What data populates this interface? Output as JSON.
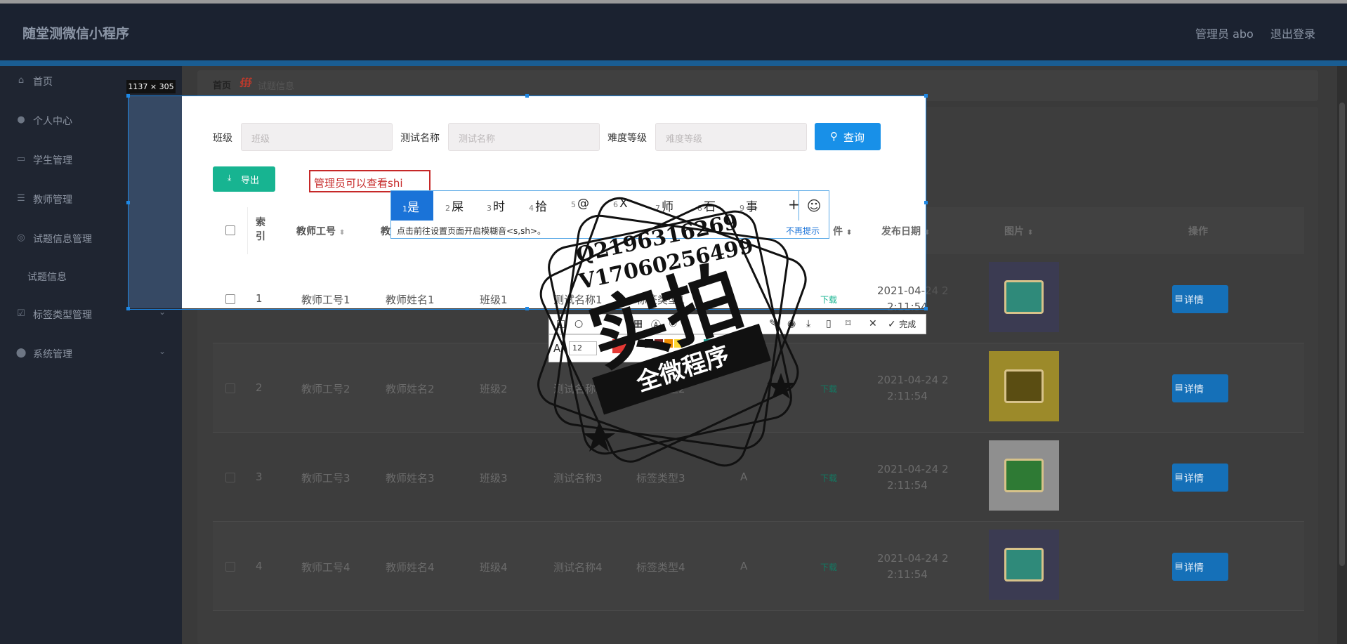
{
  "app": {
    "title": "随堂测微信小程序",
    "user": "管理员 abo",
    "logout": "退出登录"
  },
  "sidebar": {
    "items": [
      {
        "label": "首页",
        "icon": "home-icon"
      },
      {
        "label": "个人中心",
        "icon": "user-icon"
      },
      {
        "label": "学生管理",
        "icon": "chat-icon"
      },
      {
        "label": "教师管理",
        "icon": "list-icon"
      },
      {
        "label": "试题信息管理",
        "icon": "globe-icon"
      },
      {
        "label": "试题信息",
        "icon": ""
      },
      {
        "label": "标签类型管理",
        "icon": "checkbox-icon"
      },
      {
        "label": "系统管理",
        "icon": "location-icon"
      }
    ]
  },
  "breadcrumb": {
    "home": "首页",
    "current": "试题信息"
  },
  "filters": {
    "class_label": "班级",
    "class_placeholder": "班级",
    "test_label": "测试名称",
    "test_placeholder": "测试名称",
    "difficulty_label": "难度等级",
    "difficulty_placeholder": "难度等级",
    "query": "查询"
  },
  "toolbar": {
    "export": "导出"
  },
  "screenshot_tool": {
    "size_tag": "1137 × 305",
    "annotation_text": "管理员可以查看shi",
    "done": "完成",
    "font_size": "12"
  },
  "ime": {
    "candidates": [
      {
        "n": "1",
        "w": "是"
      },
      {
        "n": "2",
        "w": "屎"
      },
      {
        "n": "3",
        "w": "时"
      },
      {
        "n": "4",
        "w": "拾"
      },
      {
        "n": "5",
        "w": "@"
      },
      {
        "n": "6",
        "w": "X"
      },
      {
        "n": "7",
        "w": "师"
      },
      {
        "n": "8",
        "w": "石"
      },
      {
        "n": "9",
        "w": "事"
      }
    ],
    "plus": "+",
    "hint": "点击前往设置页面开启模糊音<s,sh>。",
    "no_hint": "不再提示"
  },
  "table": {
    "headers": [
      "索引",
      "教师工号",
      "教",
      "件",
      "发布日期",
      "图片",
      "操作"
    ],
    "rows": [
      {
        "index": "1",
        "tid": "教师工号1",
        "tname": "教师姓名1",
        "cls": "班级1",
        "test": "测试名称1",
        "tag": "标签类型1",
        "level": "",
        "file": "下载",
        "date1": "2021-04-24 2",
        "date2": "2:11:54",
        "action": "详情"
      },
      {
        "index": "2",
        "tid": "教师工号2",
        "tname": "教师姓名2",
        "cls": "班级2",
        "test": "测试名称2",
        "tag": "标签类型2",
        "level": "",
        "file": "下载",
        "date1": "2021-04-24 2",
        "date2": "2:11:54",
        "action": "详情"
      },
      {
        "index": "3",
        "tid": "教师工号3",
        "tname": "教师姓名3",
        "cls": "班级3",
        "test": "测试名称3",
        "tag": "标签类型3",
        "level": "A",
        "file": "下载",
        "date1": "2021-04-24 2",
        "date2": "2:11:54",
        "action": "详情"
      },
      {
        "index": "4",
        "tid": "教师工号4",
        "tname": "教师姓名4",
        "cls": "班级4",
        "test": "测试名称4",
        "tag": "标签类型4",
        "level": "A",
        "file": "下载",
        "date1": "2021-04-24 2",
        "date2": "2:11:54",
        "action": "详情"
      }
    ]
  },
  "watermark": {
    "line1": "Q2196316269",
    "line2": "V17060256499",
    "big": "实拍",
    "banner": "全微程序"
  }
}
